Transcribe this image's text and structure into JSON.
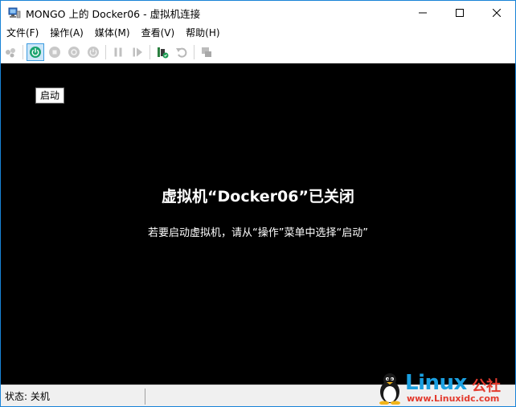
{
  "window": {
    "title": "MONGO 上的 Docker06 - 虚拟机连接",
    "controls": {
      "minimize": "minimize-icon",
      "maximize": "maximize-icon",
      "close": "close-icon"
    }
  },
  "menu": {
    "items": [
      {
        "label": "文件(F)"
      },
      {
        "label": "操作(A)"
      },
      {
        "label": "媒体(M)"
      },
      {
        "label": "查看(V)"
      },
      {
        "label": "帮助(H)"
      }
    ]
  },
  "toolbar": {
    "buttons": [
      {
        "icon": "ctrl-alt-del-icon",
        "state": "disabled"
      },
      {
        "icon": "power-start-icon",
        "state": "active"
      },
      {
        "icon": "stop-icon",
        "state": "disabled"
      },
      {
        "icon": "shutdown-icon",
        "state": "disabled"
      },
      {
        "icon": "power-off-icon",
        "state": "disabled"
      },
      {
        "icon": "pause-icon",
        "state": "disabled"
      },
      {
        "icon": "resume-icon",
        "state": "disabled"
      },
      {
        "icon": "checkpoint-icon",
        "state": "enabled"
      },
      {
        "icon": "revert-icon",
        "state": "disabled"
      },
      {
        "icon": "enhanced-session-icon",
        "state": "disabled"
      }
    ],
    "tooltip": "启动"
  },
  "display": {
    "title": "虚拟机“Docker06”已关闭",
    "subtitle": "若要启动虚拟机，请从“操作”菜单中选择“启动”"
  },
  "status": {
    "text": "状态: 关机"
  },
  "watermark": {
    "brand": "Linux",
    "brand_cn": "公社",
    "url": "www.Linuxidc.com"
  },
  "colors": {
    "accent": "#1883d7",
    "display_bg": "#000000",
    "status_bg": "#f0f0f0",
    "active_button_bg": "#cce6f8"
  }
}
